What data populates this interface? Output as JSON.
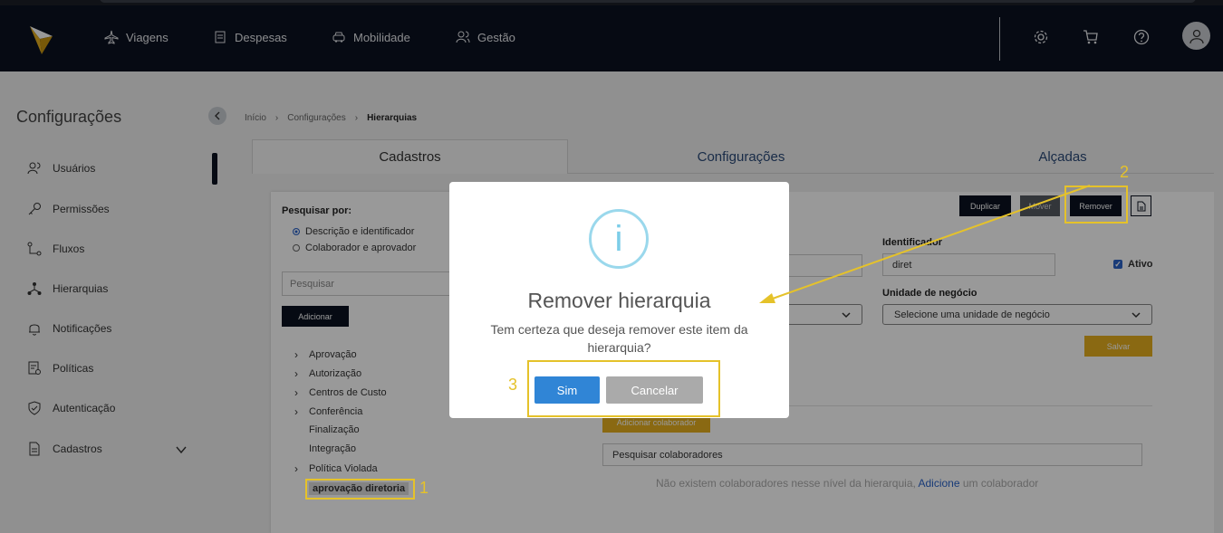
{
  "topnav": {
    "items": [
      {
        "label": "Viagens",
        "icon": "plane-icon"
      },
      {
        "label": "Despesas",
        "icon": "receipt-icon"
      },
      {
        "label": "Mobilidade",
        "icon": "car-icon"
      },
      {
        "label": "Gestão",
        "icon": "users-icon"
      }
    ]
  },
  "sidebar": {
    "title": "Configurações",
    "items": [
      {
        "label": "Usuários",
        "icon": "users-icon"
      },
      {
        "label": "Permissões",
        "icon": "key-icon"
      },
      {
        "label": "Fluxos",
        "icon": "flow-icon"
      },
      {
        "label": "Hierarquias",
        "icon": "hierarchy-icon"
      },
      {
        "label": "Notificações",
        "icon": "bell-icon"
      },
      {
        "label": "Políticas",
        "icon": "policy-icon"
      },
      {
        "label": "Autenticação",
        "icon": "shield-icon"
      },
      {
        "label": "Cadastros",
        "icon": "document-icon"
      }
    ]
  },
  "breadcrumb": {
    "home": "Início",
    "section": "Configurações",
    "current": "Hierarquias"
  },
  "tabs": [
    "Cadastros",
    "Configurações",
    "Alçadas"
  ],
  "left_panel": {
    "search_by_label": "Pesquisar por:",
    "radio_options": [
      "Descrição e identificador",
      "Colaborador e aprovador"
    ],
    "selected_radio": "Descrição e identificador",
    "search_placeholder": "Pesquisar",
    "add_label": "Adicionar",
    "tree": [
      {
        "label": "Aprovação",
        "expandable": true
      },
      {
        "label": "Autorização",
        "expandable": true
      },
      {
        "label": "Centros de Custo",
        "expandable": true
      },
      {
        "label": "Conferência",
        "expandable": true
      },
      {
        "label": "Finalização",
        "expandable": false
      },
      {
        "label": "Integração",
        "expandable": false
      },
      {
        "label": "Política Violada",
        "expandable": true
      },
      {
        "label": "aprovação diretoria",
        "expandable": false,
        "selected": true
      }
    ]
  },
  "right_panel": {
    "duplicate_label": "Duplicar",
    "move_label": "Mover",
    "remove_label": "Remover",
    "identifier_label": "Identificador",
    "identifier_value": "diret",
    "active_label": "Ativo",
    "active_checked": true,
    "business_unit_label": "Unidade de negócio",
    "business_unit_placeholder": "Selecione uma unidade de negócio",
    "save_label": "Salvar",
    "add_collaborator_label": "Adicionar colaborador",
    "search_collaborators_placeholder": "Pesquisar colaboradores",
    "empty_prefix": "Não existem colaboradores nesse nível da hierarquia,",
    "empty_link": "Adicione",
    "empty_suffix": "um colaborador"
  },
  "modal": {
    "icon_glyph": "i",
    "title": "Remover hierarquia",
    "text": "Tem certeza que deseja remover este item da hierarquia?",
    "confirm_label": "Sim",
    "cancel_label": "Cancelar"
  },
  "annotations": [
    "1",
    "2",
    "3"
  ],
  "colors": {
    "topbar": "#0b1220",
    "accent_gold": "#e6b01e",
    "confirm_blue": "#3085d6",
    "cancel_gray": "#aaaaaa",
    "annotation_yellow": "#e5c22a"
  }
}
